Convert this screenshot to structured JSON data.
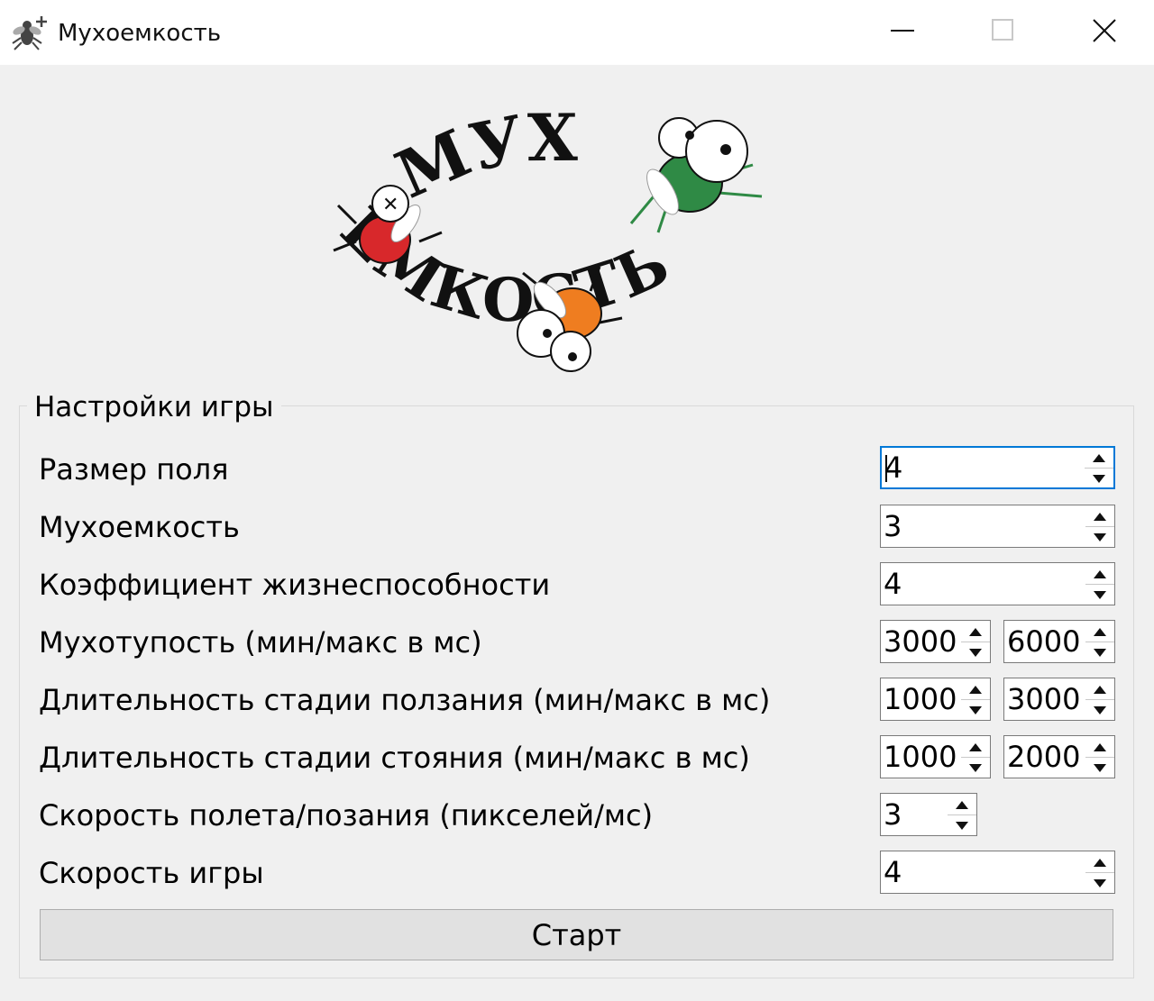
{
  "window": {
    "title": "Мухоемкость",
    "app_icon": "fly-icon",
    "controls": [
      "minimize-icon",
      "maximize-icon",
      "close-icon"
    ]
  },
  "logo": {
    "line1": "МУХ",
    "line2": "ЕМКОСТЬ",
    "fly_colors": [
      "#d8282b",
      "#2f8a45",
      "#ef7d20"
    ]
  },
  "settings": {
    "title": "Настройки игры",
    "field_size": {
      "label": "Размер поля",
      "value": "4"
    },
    "fly_capacity": {
      "label": "Мухоемкость",
      "value": "3"
    },
    "vitality": {
      "label": "Коэффициент жизнеспособности",
      "value": "4"
    },
    "fly_stupidity": {
      "label": "Мухотупость (мин/макс в мс)",
      "min": "3000",
      "max": "6000"
    },
    "crawl_duration": {
      "label": "Длительность стадии ползания (мин/макс в мс)",
      "min": "1000",
      "max": "3000"
    },
    "stand_duration": {
      "label": "Длительность стадии стояния (мин/макс в мс)",
      "min": "1000",
      "max": "2000"
    },
    "flight_speed": {
      "label": "Скорость полета/позания (пикселей/мс)",
      "value": "3"
    },
    "game_speed": {
      "label": "Скорость игры",
      "value": "4"
    }
  },
  "start_label": "Старт",
  "colors": {
    "window_bg": "#f0f0f0",
    "focus_border": "#0078d7",
    "button_bg": "#e1e1e1"
  }
}
